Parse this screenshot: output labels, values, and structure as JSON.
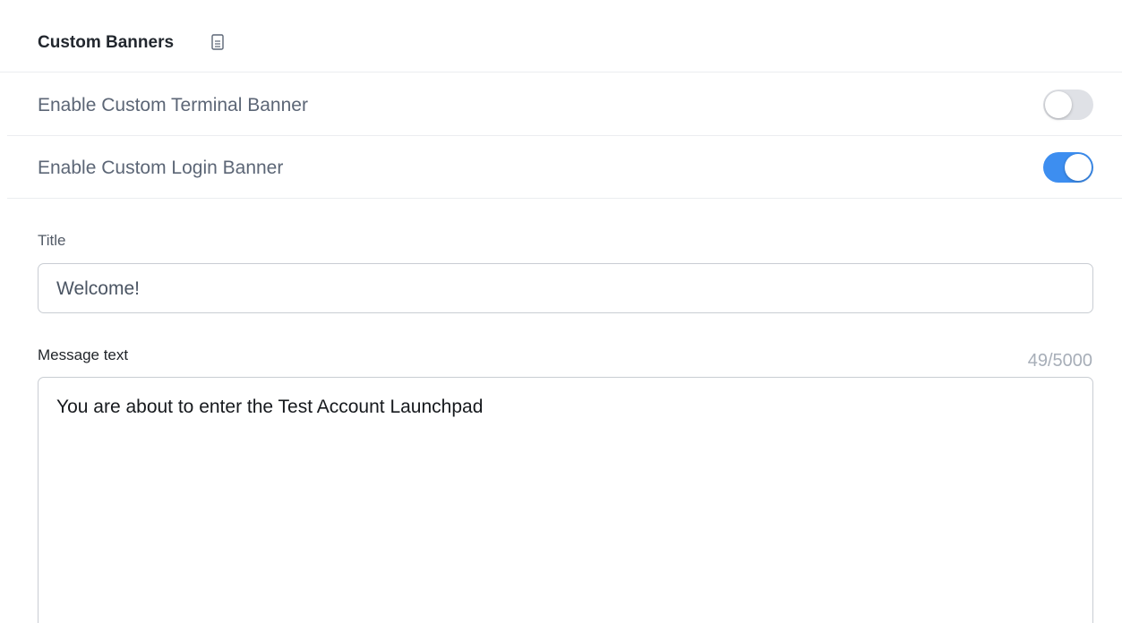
{
  "section": {
    "title": "Custom Banners",
    "title_icon": "doc-icon"
  },
  "settings": [
    {
      "label": "Enable Custom Terminal Banner",
      "enabled": false
    },
    {
      "label": "Enable Custom Login Banner",
      "enabled": true
    }
  ],
  "form": {
    "title_label": "Title",
    "title_value": "Welcome!",
    "message_label": "Message text",
    "message_counter": "49/5000",
    "message_value": "You are about to enter the Test Account Launchpad"
  },
  "colors": {
    "toggle_on": "#3d8ef0",
    "toggle_off": "#dfe1e6"
  }
}
